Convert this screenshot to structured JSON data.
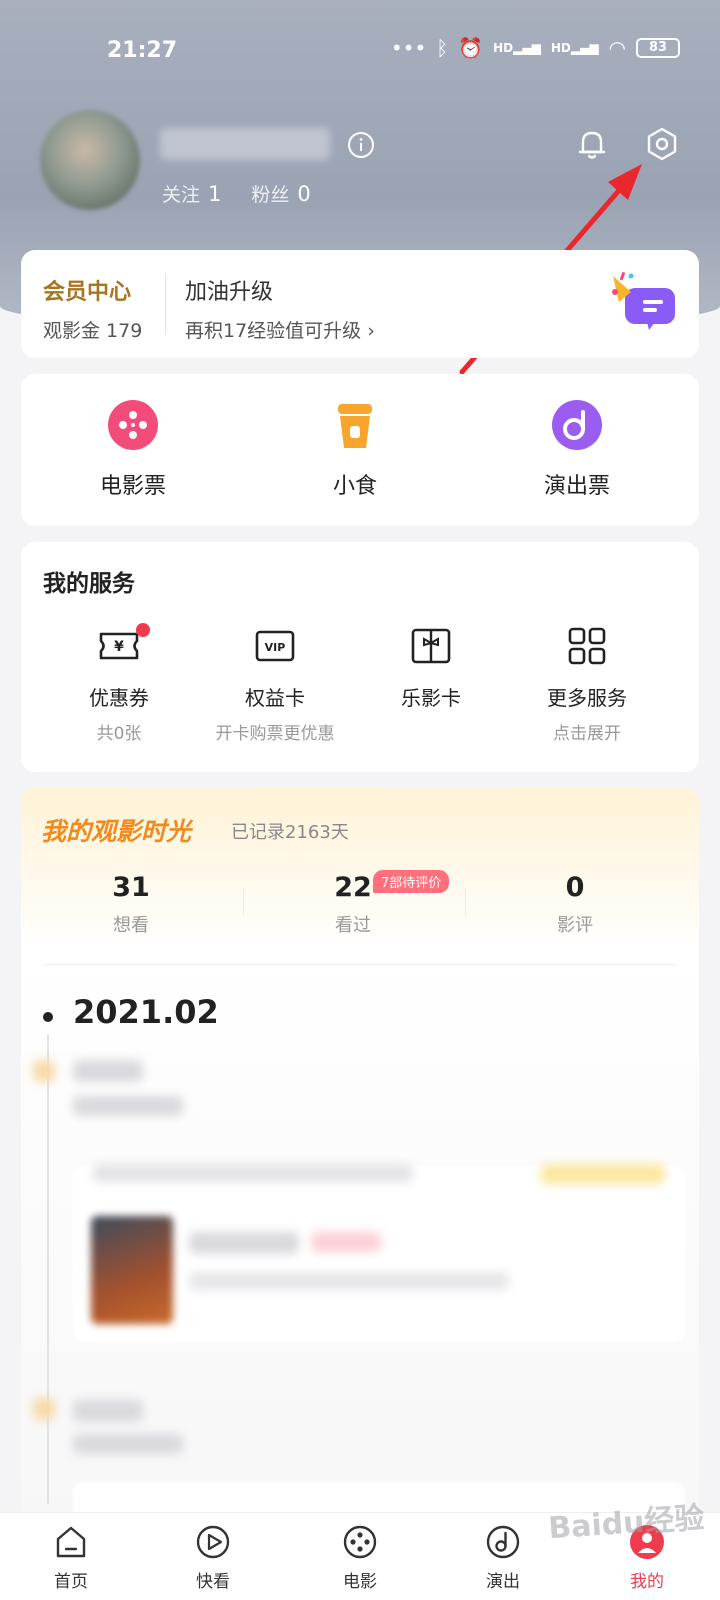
{
  "status_bar": {
    "time": "21:27",
    "network_label": "HD",
    "battery": "83"
  },
  "profile": {
    "follow_label": "关注",
    "follow_count": "1",
    "fans_label": "粉丝",
    "fans_count": "0"
  },
  "member": {
    "title": "会员中心",
    "coins_label": "观影金 179",
    "upgrade_title": "加油升级",
    "upgrade_hint": "再积17经验值可升级 ›"
  },
  "quick_entries": [
    {
      "label": "电影票",
      "icon": "film-reel-icon",
      "color": "#f34c7a"
    },
    {
      "label": "小食",
      "icon": "drink-cup-icon",
      "color": "#f7a52c"
    },
    {
      "label": "演出票",
      "icon": "music-disc-icon",
      "color": "#9b5cf0"
    }
  ],
  "services": {
    "title": "我的服务",
    "items": [
      {
        "label": "优惠券",
        "sub": "共0张",
        "icon": "coupon-icon"
      },
      {
        "label": "权益卡",
        "sub": "开卡购票更优惠",
        "icon": "vip-card-icon"
      },
      {
        "label": "乐影卡",
        "sub": "",
        "icon": "gift-card-icon"
      },
      {
        "label": "更多服务",
        "sub": "点击展开",
        "icon": "grid-icon"
      }
    ]
  },
  "movie_time": {
    "title": "我的观影时光",
    "recorded": "已记录2163天",
    "stats": [
      {
        "num": "31",
        "label": "想看"
      },
      {
        "num": "22",
        "label": "看过"
      },
      {
        "num": "0",
        "label": "影评"
      }
    ],
    "pending_badge": "7部待评价",
    "month": "2021.02"
  },
  "tabs": [
    {
      "label": "首页",
      "icon": "home-icon"
    },
    {
      "label": "快看",
      "icon": "play-icon"
    },
    {
      "label": "电影",
      "icon": "film-icon"
    },
    {
      "label": "演出",
      "icon": "music-note-icon"
    },
    {
      "label": "我的",
      "icon": "profile-icon"
    }
  ],
  "watermark": "Baidu经验",
  "colors": {
    "accent": "#f03b4f",
    "member_gold": "#a8741f",
    "time_orange": "#f08a1e",
    "annotation_arrow": "#e8282c"
  }
}
